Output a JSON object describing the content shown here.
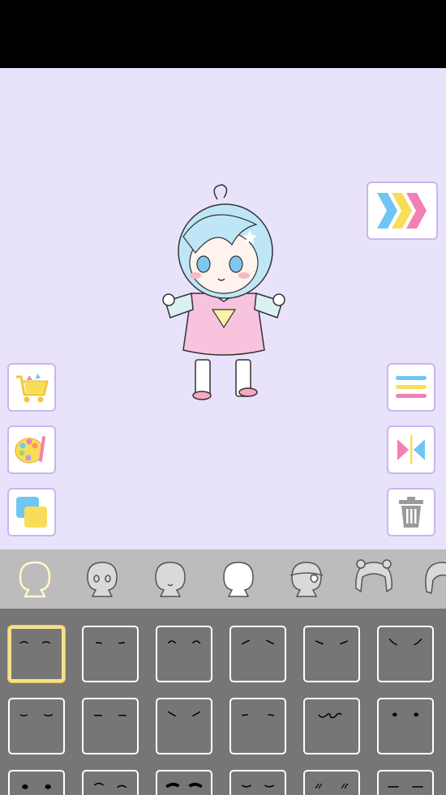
{
  "colors": {
    "stage_bg": "#e8e2fb",
    "button_border": "#c9b6ee",
    "tab_bar_bg": "#bcbcbc",
    "grid_bg": "#767676",
    "selected_border": "#f6e08a",
    "accent_blue": "#6fc6f2",
    "accent_yellow": "#f8de58",
    "accent_pink": "#f47fb4"
  },
  "toolbar_left": [
    {
      "icon": "shopping-cart-icon"
    },
    {
      "icon": "palette-icon"
    },
    {
      "icon": "layers-icon"
    }
  ],
  "toolbar_right": [
    {
      "icon": "next-arrows-icon"
    },
    {
      "icon": "menu-icon"
    },
    {
      "icon": "flip-icon"
    },
    {
      "icon": "trash-icon"
    }
  ],
  "category_tabs": [
    {
      "icon": "body-outline-icon",
      "selected": true
    },
    {
      "icon": "eyes-icon",
      "selected": false
    },
    {
      "icon": "mouth-icon",
      "selected": false
    },
    {
      "icon": "face-icon",
      "selected": false
    },
    {
      "icon": "accessory-eyepatch-icon",
      "selected": false
    },
    {
      "icon": "hair-icon",
      "selected": false
    },
    {
      "icon": "hair-side-icon",
      "selected": false
    }
  ],
  "eyebrow_grid": {
    "selected_index": 0,
    "items": [
      "arc-flat",
      "flat-short",
      "arc-up",
      "slant-in",
      "slant-out",
      "angry",
      "droop",
      "straight",
      "v-shape",
      "dash",
      "swirl",
      "dots",
      "dots-big",
      "wave",
      "thick",
      "double",
      "scribble",
      "flat-long"
    ]
  }
}
